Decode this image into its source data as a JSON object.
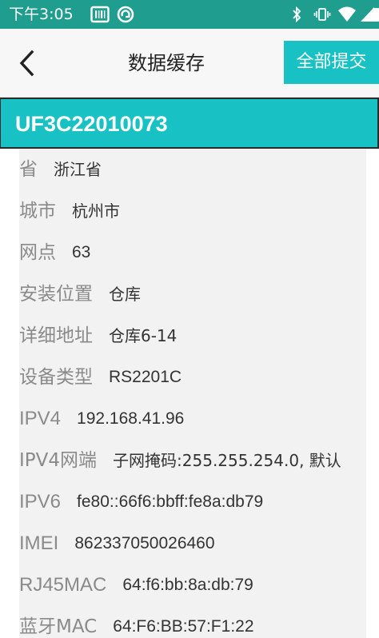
{
  "status_bar": {
    "time": "下午3:05",
    "left_icons": [
      "barcode-icon",
      "sync-circle-icon"
    ],
    "right_icons": [
      "bluetooth-icon",
      "vibrate-icon",
      "wifi-icon",
      "signal-icon",
      "battery-icon"
    ]
  },
  "app_bar": {
    "back_icon": "back-arrow-icon",
    "title": "数据缓存",
    "submit_label": "全部提交"
  },
  "device": {
    "id": "UF3C22010073"
  },
  "details": [
    {
      "label": "省",
      "value": "浙江省"
    },
    {
      "label": "城市",
      "value": "杭州市"
    },
    {
      "label": "网点",
      "value": "63"
    },
    {
      "label": "安装位置",
      "value": "仓库"
    },
    {
      "label": "详细地址",
      "value": "仓库6-14"
    },
    {
      "label": "设备类型",
      "value": "RS2201C"
    },
    {
      "label": "IPV4",
      "value": "192.168.41.96"
    },
    {
      "label": "IPV4网端",
      "value": "子网掩码:255.255.254.0, 默认"
    },
    {
      "label": "IPV6",
      "value": "fe80::66f6:bbff:fe8a:db79"
    },
    {
      "label": "IMEI",
      "value": "862337050026460"
    },
    {
      "label": "RJ45MAC",
      "value": "64:f6:bb:8a:db:79"
    },
    {
      "label": "蓝牙MAC",
      "value": "64:F6:BB:57:F1:22"
    }
  ],
  "colors": {
    "status_bar": "#1f9d8f",
    "accent": "#18c1c4",
    "panel": "#f2f2f2"
  }
}
